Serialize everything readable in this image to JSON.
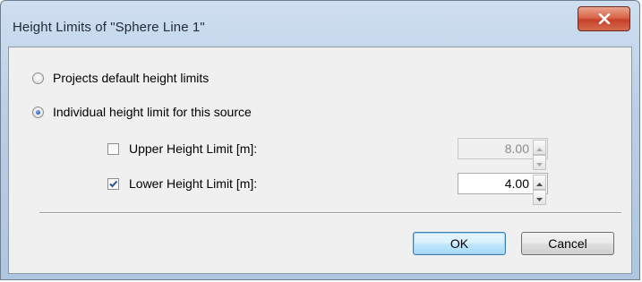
{
  "window": {
    "title": "Height Limits of \"Sphere Line 1\"",
    "close_icon": "close-x-icon"
  },
  "options": {
    "project_default_label": "Projects default height limits",
    "project_default_selected": false,
    "individual_label": "Individual height limit for this source",
    "individual_selected": true
  },
  "upper": {
    "label": "Upper Height Limit [m]:",
    "checked": false,
    "value": "8.00",
    "enabled": false
  },
  "lower": {
    "label": "Lower Height Limit [m]:",
    "checked": true,
    "value": "4.00",
    "enabled": true
  },
  "buttons": {
    "ok_label": "OK",
    "cancel_label": "Cancel"
  },
  "colors": {
    "title_bar": "#b9cfe6",
    "close_button": "#d9654a",
    "default_button_border": "#3c7fb1",
    "check_mark": "#2b4f8e"
  }
}
